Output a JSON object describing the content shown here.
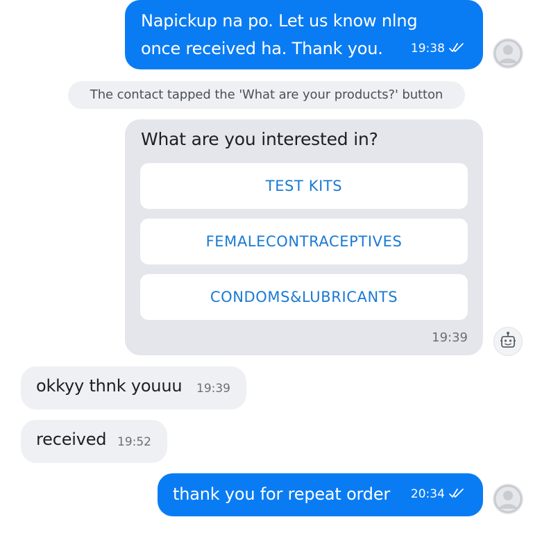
{
  "messages": {
    "out1": {
      "line1": "Napickup na po. Let us know nlng",
      "line2": "once received ha. Thank you.",
      "time": "19:38",
      "status_icon": "double-check-icon"
    },
    "system_note": "The contact tapped the 'What are your products?' button",
    "bot_card": {
      "question": "What are you interested in?",
      "options": [
        "TEST KITS",
        "FEMALECONTRACEPTIVES",
        "CONDOMS&LUBRICANTS"
      ],
      "time": "19:39",
      "sender_icon": "bot-icon"
    },
    "in1": {
      "text": "okkyy thnk youuu",
      "time": "19:39"
    },
    "in2": {
      "text": "received",
      "time": "19:52"
    },
    "out2": {
      "text": "thank you for repeat order",
      "time": "20:34",
      "status_icon": "double-check-icon"
    }
  },
  "colors": {
    "outgoing_bubble": "#0a7cf3",
    "incoming_bubble": "#eef0f3",
    "bot_card": "#e4e6eb",
    "option_text": "#1a79d2",
    "page_background": "#ffffff"
  },
  "avatars": [
    "user-avatar-icon",
    "user-avatar-icon"
  ]
}
